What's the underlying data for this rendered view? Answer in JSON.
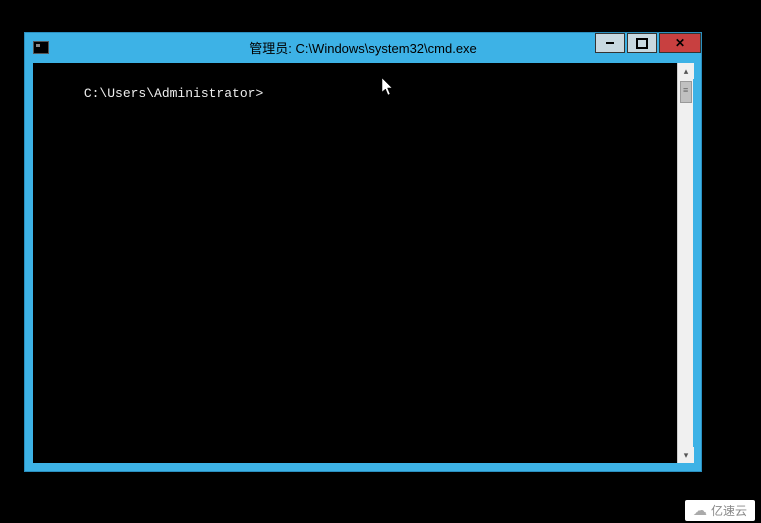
{
  "window": {
    "title": "管理员: C:\\Windows\\system32\\cmd.exe"
  },
  "terminal": {
    "prompt": "C:\\Users\\Administrator>"
  },
  "watermark": {
    "text": "亿速云"
  }
}
